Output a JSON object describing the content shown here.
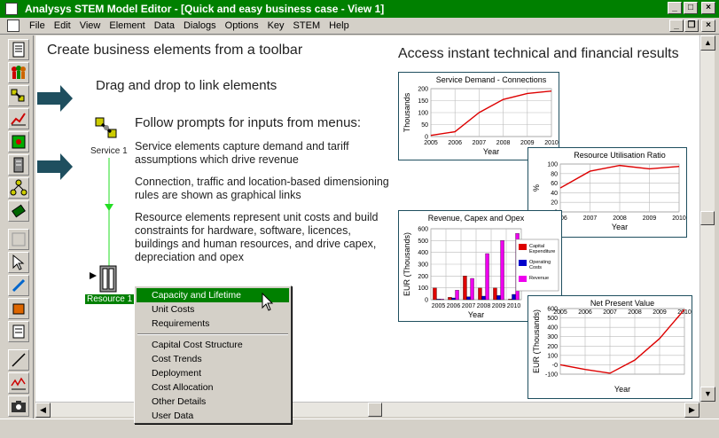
{
  "window": {
    "title": "Analysys STEM Model Editor - [Quick and easy business case - View 1]",
    "minimize": "_",
    "maximize": "□",
    "close": "×"
  },
  "menu": [
    "File",
    "Edit",
    "View",
    "Element",
    "Data",
    "Dialogs",
    "Options",
    "Key",
    "STEM",
    "Help"
  ],
  "mdi": {
    "minimize": "_",
    "restore": "❐",
    "close": "×"
  },
  "toolbar": [
    "service-element",
    "network-element",
    "transformation-element",
    "rate-element",
    "location-element",
    "resource-element",
    "link-element",
    "function-element",
    "group-element",
    "template-element",
    "edit-element",
    "collection-element",
    "results-element",
    "line-tool",
    "graph-tool",
    "camera-tool"
  ],
  "canvas": {
    "heading_left": "Create business elements from a toolbar",
    "heading_right": "Access instant technical and financial results",
    "drag_drop": "Drag and drop to link elements",
    "prompts": "Follow prompts for inputs from menus:",
    "para1": "Service elements capture demand and tariff assumptions which drive revenue",
    "para2": "Connection, traffic and location-based dimensioning rules are shown as graphical links",
    "para3": "Resource elements represent unit costs and build constraints for hardware, software, licences, buildings and human resources, and drive capex, depreciation and opex",
    "service_label": "Service 1",
    "resource_label": "Resource 1"
  },
  "context_menu": {
    "group1": [
      "Capacity and Lifetime",
      "Unit Costs",
      "Requirements"
    ],
    "group2": [
      "Capital Cost Structure",
      "Cost Trends",
      "Deployment",
      "Cost Allocation",
      "Other Details",
      "User Data"
    ],
    "selected": "Capacity and Lifetime"
  },
  "chart_data": [
    {
      "type": "line",
      "title": "Service Demand - Connections",
      "xlabel": "Year",
      "ylabel": "Thousands",
      "x": [
        "2005",
        "2006",
        "2007",
        "2008",
        "2009",
        "2010"
      ],
      "y_ticks": [
        "0",
        "50",
        "100",
        "150",
        "200"
      ],
      "ylim": [
        0,
        200
      ],
      "series": [
        {
          "values": [
            5,
            20,
            100,
            155,
            180,
            190
          ],
          "color": "#dd0000"
        }
      ]
    },
    {
      "type": "line",
      "title": "Resource Utilisation Ratio",
      "xlabel": "Year",
      "ylabel": "%",
      "x": [
        "2006",
        "2007",
        "2008",
        "2009",
        "2010"
      ],
      "y_ticks": [
        "0",
        "20",
        "40",
        "60",
        "80",
        "100"
      ],
      "ylim": [
        0,
        100
      ],
      "series": [
        {
          "values": [
            50,
            85,
            97,
            90,
            95
          ],
          "color": "#dd0000"
        }
      ]
    },
    {
      "type": "bar",
      "title": "Revenue, Capex and Opex",
      "xlabel": "Year",
      "ylabel": "EUR (Thousands)",
      "categories": [
        "2005",
        "2006",
        "2007",
        "2008",
        "2009",
        "2010"
      ],
      "y_ticks": [
        "0",
        "100",
        "200",
        "300",
        "400",
        "500",
        "600"
      ],
      "ylim": [
        0,
        600
      ],
      "series": [
        {
          "name": "Capital Expenditure",
          "values": [
            100,
            20,
            200,
            100,
            100,
            5
          ],
          "color": "#dd0000"
        },
        {
          "name": "Operating Costs",
          "values": [
            5,
            15,
            25,
            30,
            35,
            45
          ],
          "color": "#0000cc"
        },
        {
          "name": "Revenue",
          "values": [
            5,
            80,
            180,
            390,
            500,
            560
          ],
          "color": "#ee00ee"
        }
      ]
    },
    {
      "type": "line",
      "title": "Net Present Value",
      "xlabel": "Year",
      "ylabel": "EUR (Thousands)",
      "x": [
        "2005",
        "2006",
        "2007",
        "2008",
        "2009",
        "2010"
      ],
      "y_ticks": [
        "-100",
        "0",
        "100",
        "200",
        "300",
        "400",
        "500",
        "600"
      ],
      "y_tick_labels": [
        "-100",
        "-0",
        "100",
        "200",
        "300",
        "400",
        "500",
        "600"
      ],
      "ylim": [
        -100,
        600
      ],
      "series": [
        {
          "values": [
            0,
            -50,
            -90,
            50,
            280,
            590
          ],
          "color": "#dd0000"
        }
      ]
    }
  ]
}
